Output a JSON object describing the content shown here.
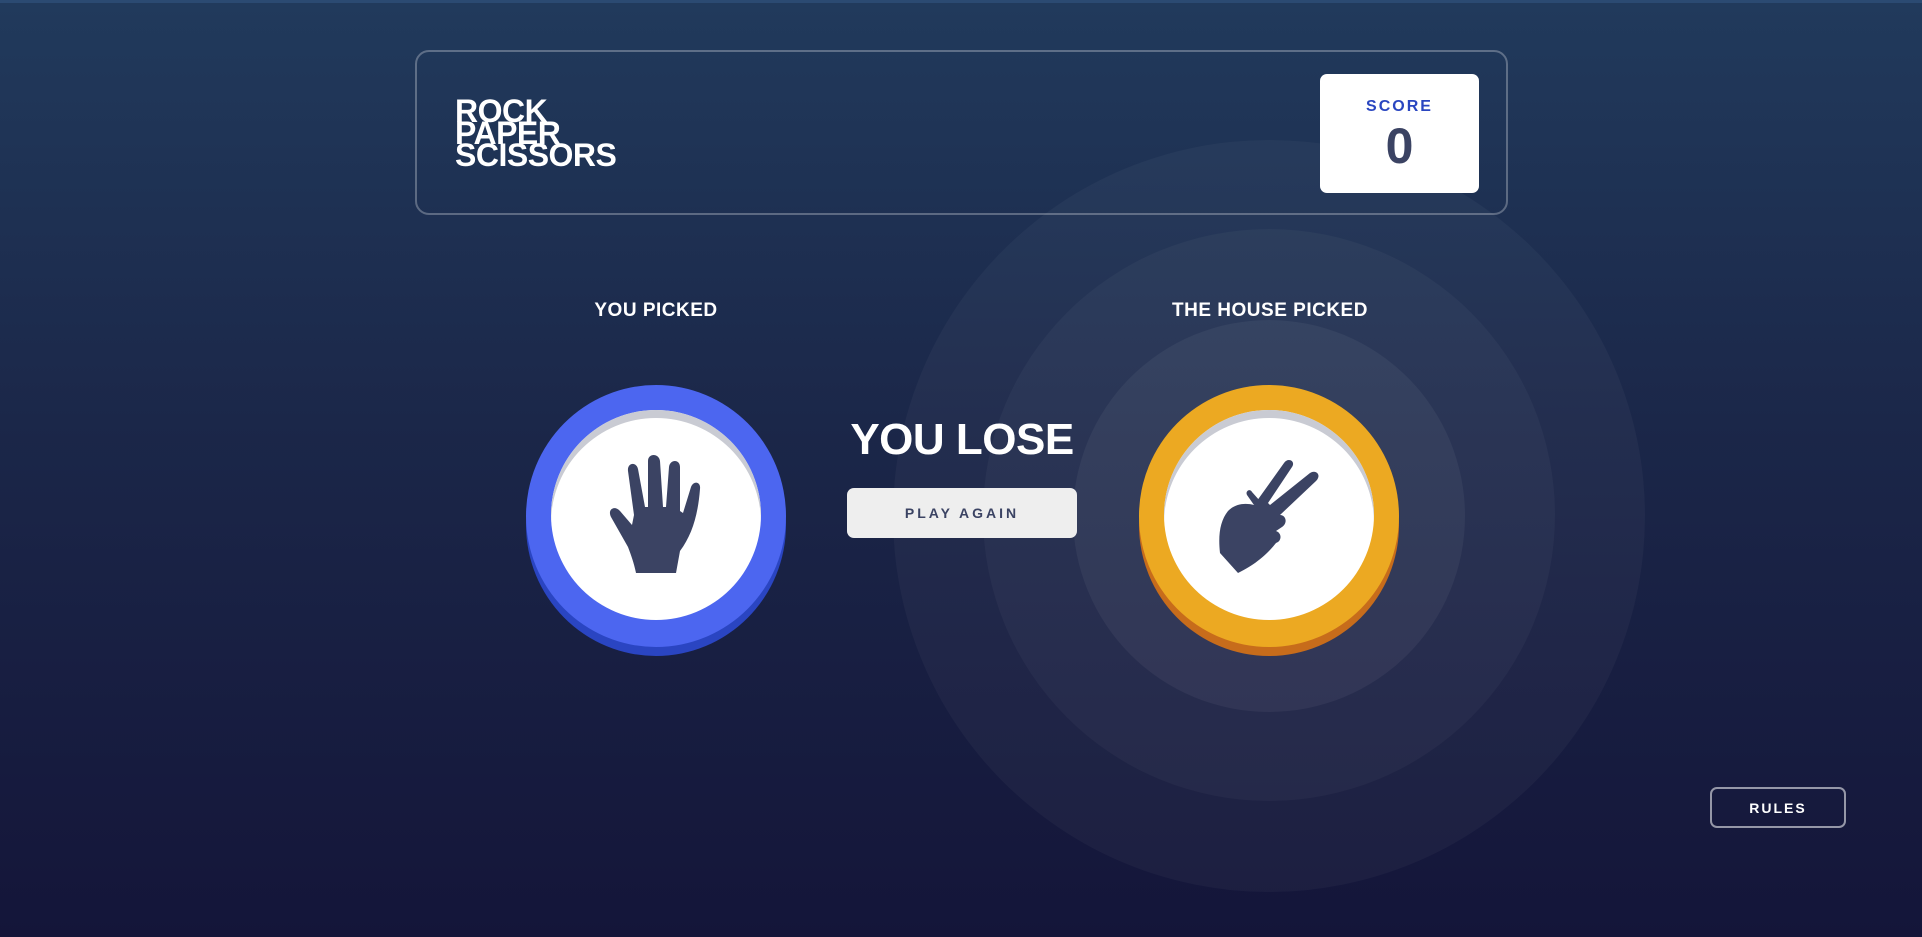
{
  "header": {
    "logo_lines": [
      "ROCK",
      "PAPER",
      "SCISSORS"
    ],
    "score_label": "SCORE",
    "score_value": "0"
  },
  "game": {
    "you_picked_label": "YOU PICKED",
    "house_picked_label": "THE HOUSE PICKED",
    "player_choice": "paper",
    "house_choice": "scissors",
    "result_text": "YOU LOSE",
    "play_again_label": "PLAY AGAIN"
  },
  "footer": {
    "rules_label": "RULES"
  },
  "colors": {
    "paper": "#4c66f0",
    "scissors": "#eca922",
    "icon": "#3b4363"
  },
  "icons": {
    "player": "paper-hand-icon",
    "house": "scissors-hand-icon"
  }
}
